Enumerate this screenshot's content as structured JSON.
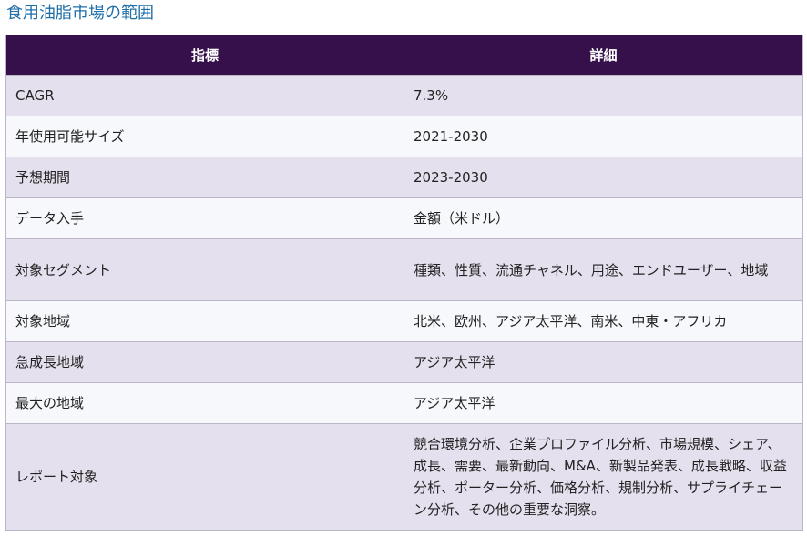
{
  "title": "食用油脂市場の範囲",
  "table": {
    "headers": [
      "指標",
      "詳細"
    ],
    "rows": [
      [
        "CAGR",
        "7.3%"
      ],
      [
        "年使用可能サイズ",
        "2021-2030"
      ],
      [
        "予想期間",
        "2023-2030"
      ],
      [
        "データ入手",
        "金額（米ドル）"
      ],
      [
        "対象セグメント",
        "種類、性質、流通チャネル、用途、エンドユーザー、地域"
      ],
      [
        "対象地域",
        "北米、欧州、アジア太平洋、南米、中東・アフリカ"
      ],
      [
        "急成長地域",
        "アジア太平洋"
      ],
      [
        "最大の地域",
        "アジア太平洋"
      ],
      [
        "レポート対象",
        "競合環境分析、企業プロファイル分析、市場規模、シェア、成長、需要、最新動向、M&A、新製品発表、成長戦略、収益分析、ポーター分析、価格分析、規制分析、サプライチェーン分析、その他の重要な洞察。"
      ]
    ]
  }
}
